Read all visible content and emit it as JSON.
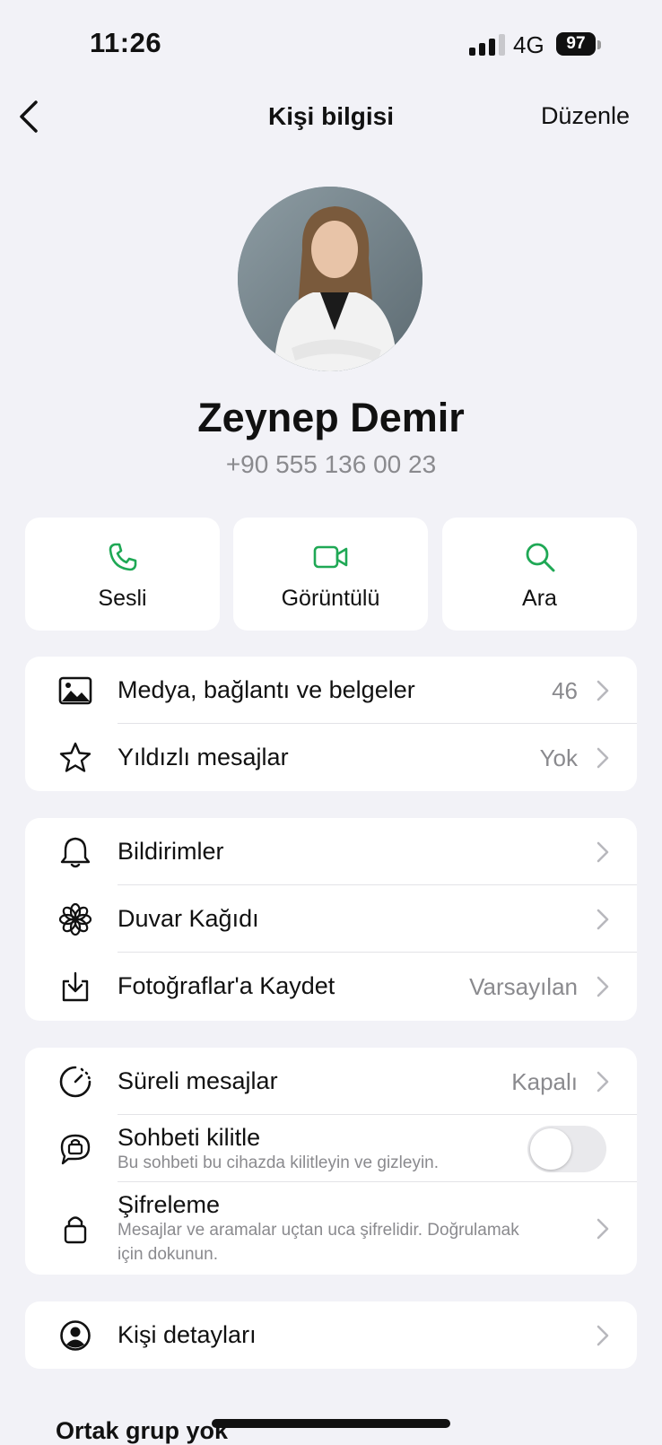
{
  "status": {
    "time": "11:26",
    "network": "4G",
    "battery": "97"
  },
  "nav": {
    "title": "Kişi bilgisi",
    "edit_label": "Düzenle"
  },
  "contact": {
    "name": "Zeynep Demir",
    "phone": "+90 555 136 00 23"
  },
  "actions": [
    {
      "label": "Sesli",
      "icon": "phone-icon"
    },
    {
      "label": "Görüntülü",
      "icon": "video-camera-icon"
    },
    {
      "label": "Ara",
      "icon": "search-icon"
    }
  ],
  "group1": [
    {
      "label": "Medya, bağlantı ve belgeler",
      "value": "46",
      "icon": "photo-icon"
    },
    {
      "label": "Yıldızlı mesajlar",
      "value": "Yok",
      "icon": "star-icon"
    }
  ],
  "group2": [
    {
      "label": "Bildirimler",
      "value": "",
      "icon": "bell-icon"
    },
    {
      "label": "Duvar Kağıdı",
      "value": "",
      "icon": "flower-icon"
    },
    {
      "label": "Fotoğraflar'a Kaydet",
      "value": "Varsayılan",
      "icon": "save-download-icon"
    }
  ],
  "group3": {
    "disappearing": {
      "label": "Süreli mesajlar",
      "value": "Kapalı",
      "icon": "timer-icon"
    },
    "lock": {
      "label": "Sohbeti kilitle",
      "sub": "Bu sohbeti bu cihazda kilitleyin ve gizleyin.",
      "icon": "locked-chat-icon",
      "enabled": false
    },
    "encryption": {
      "label": "Şifreleme",
      "sub_line1": "Mesajlar ve aramalar uçtan uca şifrelidir. Doğrulamak",
      "sub_line2": "için dokunun.",
      "icon": "lock-icon"
    }
  },
  "group4": [
    {
      "label": "Kişi detayları",
      "icon": "contact-icon"
    }
  ],
  "common_groups": {
    "label": "Ortak grup yok"
  },
  "colors": {
    "accent_green": "#1fa855",
    "background": "#f2f2f7",
    "card": "#ffffff",
    "secondary_text": "#8a8a8e"
  }
}
